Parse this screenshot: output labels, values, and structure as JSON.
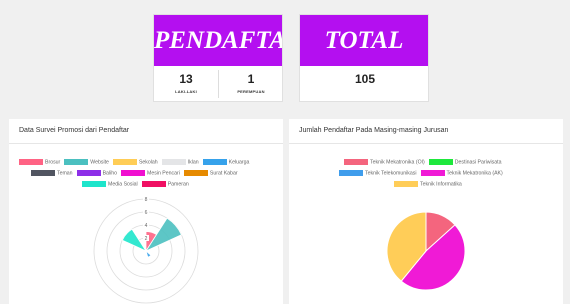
{
  "cards": {
    "pendaftar": {
      "title": "PENDAFTAR",
      "left_value": "13",
      "left_label": "LAKI-LAKI",
      "right_value": "1",
      "right_label": "PEREMPUAN"
    },
    "total": {
      "title": "TOTAL",
      "value": "105"
    }
  },
  "panels": {
    "left_title": "Data Survei Promosi dari Pendaftar",
    "right_title": "Jumlah Pendaftar Pada Masing-masing Jurusan"
  },
  "colors": {
    "header_purple": "#b40ff0"
  },
  "chart_data": [
    {
      "type": "polarArea",
      "title": "Data Survei Promosi dari Pendaftar",
      "categories": [
        "Brosur",
        "Website",
        "Sekolah",
        "Iklan",
        "Keluarga",
        "Teman",
        "Baliho",
        "Mesin Pencari",
        "Surat Kabar",
        "Media Sosial",
        "Pameran"
      ],
      "colors": [
        "#ff6384",
        "#4bc0c0",
        "#ffcd56",
        "#e4e5e7",
        "#36a2eb",
        "#515561",
        "#8d2fe8",
        "#f00fd0",
        "#e68a00",
        "#1ee5cb",
        "#f01063"
      ],
      "values": [
        3,
        6,
        0,
        0,
        1,
        0,
        0,
        0,
        0,
        4,
        0
      ],
      "ticks": [
        "2",
        "4",
        "6",
        "8"
      ],
      "ylim": [
        0,
        8
      ],
      "legend": "top"
    },
    {
      "type": "pie",
      "title": "Jumlah Pendaftar Pada Masing-masing Jurusan",
      "categories": [
        "Teknik Mekatronika (OI)",
        "Destinasi Pariwisata",
        "Teknik Telekomunikasi",
        "Teknik Mekatronika (AK)",
        "Teknik Informatika"
      ],
      "colors": [
        "#f4657e",
        "#1ee83c",
        "#3f9dec",
        "#f01ad6",
        "#ffcd58"
      ],
      "values": [
        14,
        0,
        0,
        50,
        41
      ],
      "legend": "top"
    }
  ]
}
